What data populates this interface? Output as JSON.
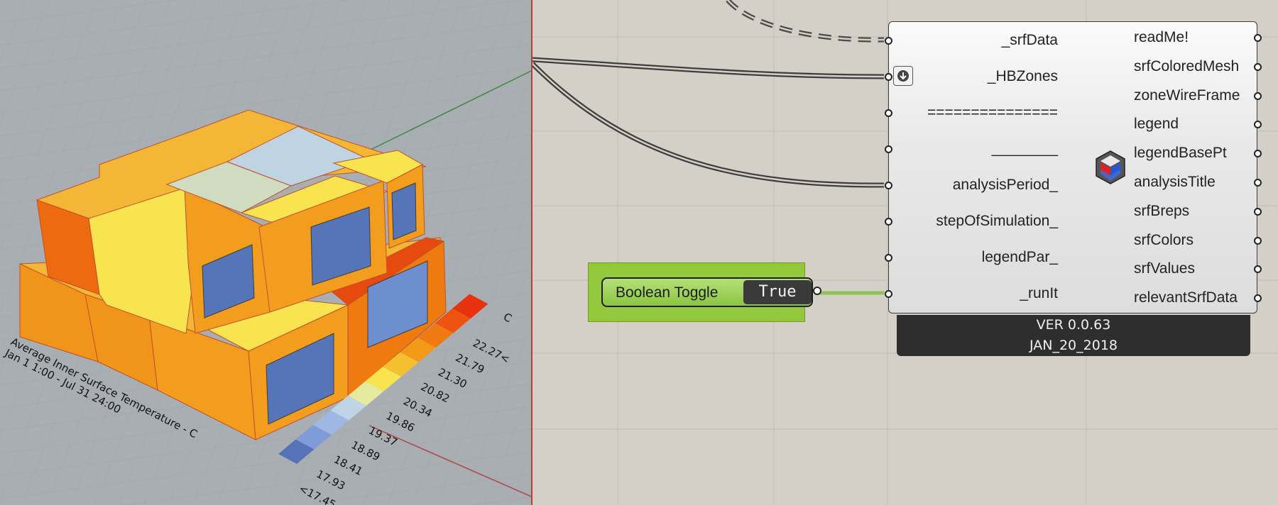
{
  "viewport": {
    "legend": {
      "unit": "C",
      "values": [
        "22.27<",
        "21.79",
        "21.30",
        "20.82",
        "20.34",
        "19.86",
        "19.37",
        "18.89",
        "18.41",
        "17.93",
        "<17.45"
      ],
      "colors": [
        "#e8320f",
        "#ee5410",
        "#f07a12",
        "#f29a17",
        "#f5c030",
        "#f7e44e",
        "#e6ea9e",
        "#c0d4e8",
        "#9fb8e3",
        "#7f9bd8",
        "#5673b8"
      ],
      "title_line1": "Average Inner Surface Temperature - C",
      "title_line2": "Jan 1 1:00 - Jul 31 24:00"
    }
  },
  "component": {
    "inputs": [
      "_srfData",
      "_HBZones",
      "===============",
      "________",
      "analysisPeriod_",
      "stepOfSimulation_",
      "legendPar_",
      "_runIt"
    ],
    "outputs": [
      "readMe!",
      "srfColoredMesh",
      "zoneWireFrame",
      "legend",
      "legendBasePt",
      "analysisTitle",
      "srfBreps",
      "srfColors",
      "srfValues",
      "relevantSrfData"
    ],
    "version": "VER 0.0.63",
    "date": "JAN_20_2018",
    "icon": "honeybee-cube-icon"
  },
  "toggle": {
    "label": "Boolean Toggle",
    "value": "True"
  }
}
